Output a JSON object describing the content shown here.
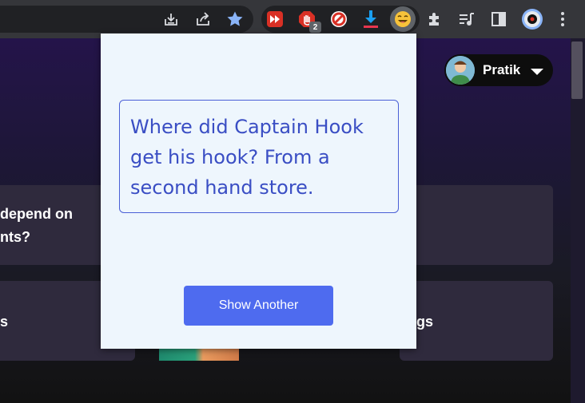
{
  "browser": {
    "extension_badge_count": "2",
    "icons": [
      "install-icon",
      "share-icon",
      "bookmark-star-icon",
      "video-speed-icon",
      "adblock-icon",
      "blocker-icon",
      "download-icon",
      "joke-extension-icon",
      "extensions-puzzle-icon",
      "media-queue-icon",
      "side-panel-icon",
      "profile-avatar-icon",
      "more-menu-icon"
    ]
  },
  "page": {
    "user": {
      "name": "Pratik"
    },
    "cards": [
      {
        "line1": "depend on",
        "line2": "nts?"
      },
      {
        "line1": "s"
      },
      {
        "line1": "gs"
      }
    ]
  },
  "popup": {
    "joke": "Where did Captain Hook get his hook? From a second hand store.",
    "button_label": "Show Another"
  },
  "colors": {
    "popup_bg": "#eef6fd",
    "joke_text": "#3a4ec4",
    "button_bg": "#4e6bef",
    "toolbar_bg": "#35363a"
  }
}
